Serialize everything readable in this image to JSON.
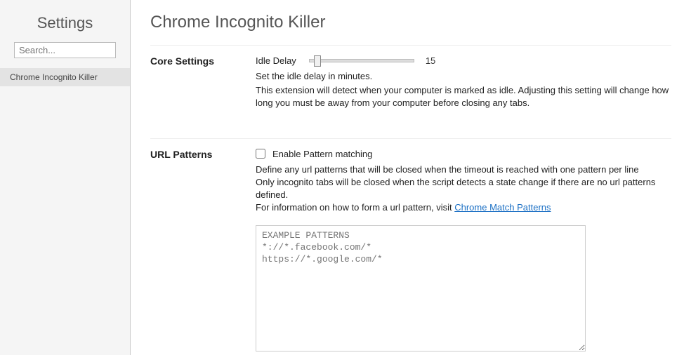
{
  "sidebar": {
    "title": "Settings",
    "search_placeholder": "Search...",
    "items": [
      {
        "label": "Chrome Incognito Killer"
      }
    ]
  },
  "page": {
    "title": "Chrome Incognito Killer"
  },
  "core": {
    "header": "Core Settings",
    "idle_label": "Idle Delay",
    "idle_value": "15",
    "help1": "Set the idle delay in minutes.",
    "help2": "This extension will detect when your computer is marked as idle. Adjusting this setting will change how long you must be away from your computer before closing any tabs."
  },
  "urlpatterns": {
    "header": "URL Patterns",
    "checkbox_label": "Enable Pattern matching",
    "desc1": "Define any url patterns that will be closed when the timeout is reached with one pattern per line",
    "desc2": "Only incognito tabs will be closed when the script detects a state change if there are no url patterns defined.",
    "desc3_pre": "For information on how to form a url pattern, visit ",
    "link_text": "Chrome Match Patterns",
    "textarea_placeholder": "EXAMPLE PATTERNS\n*://*.facebook.com/*\nhttps://*.google.com/*"
  }
}
